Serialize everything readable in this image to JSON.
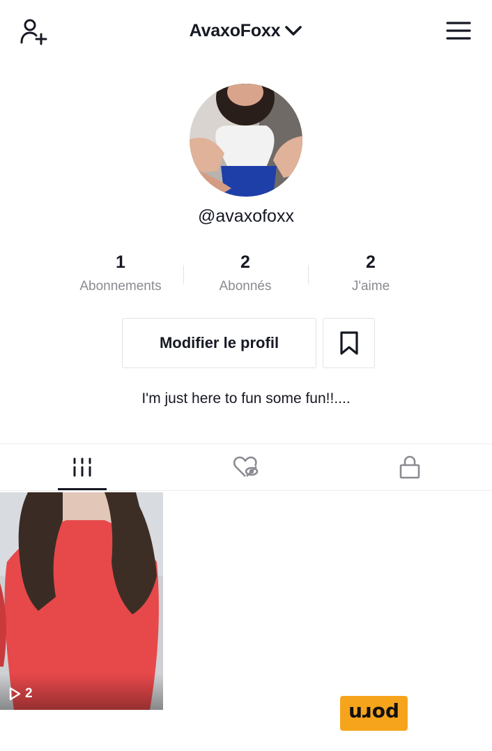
{
  "header": {
    "username": "AvaxoFoxx",
    "add_user_icon": "person-plus-icon",
    "dropdown_icon": "chevron-down-icon",
    "menu_icon": "hamburger-menu-icon"
  },
  "profile": {
    "handle": "@avaxofoxx",
    "bio": "I'm just here to fun some fun!!...."
  },
  "stats": [
    {
      "value": "1",
      "label": "Abonnements"
    },
    {
      "value": "2",
      "label": "Abonnés"
    },
    {
      "value": "2",
      "label": "J'aime"
    }
  ],
  "actions": {
    "edit_label": "Modifier le profil",
    "bookmark_icon": "bookmark-icon"
  },
  "tabs": [
    {
      "icon": "videos-grid-icon",
      "active": true
    },
    {
      "icon": "liked-hidden-icon",
      "active": false
    },
    {
      "icon": "lock-icon",
      "active": false
    }
  ],
  "videos": [
    {
      "play_count": "2",
      "play_icon": "play-outline-icon"
    }
  ],
  "watermark": {
    "text": "porn"
  },
  "colors": {
    "text": "#161823",
    "secondary": "#8a8b91",
    "border": "#e3e3e4",
    "watermark": "#f7a41d"
  }
}
